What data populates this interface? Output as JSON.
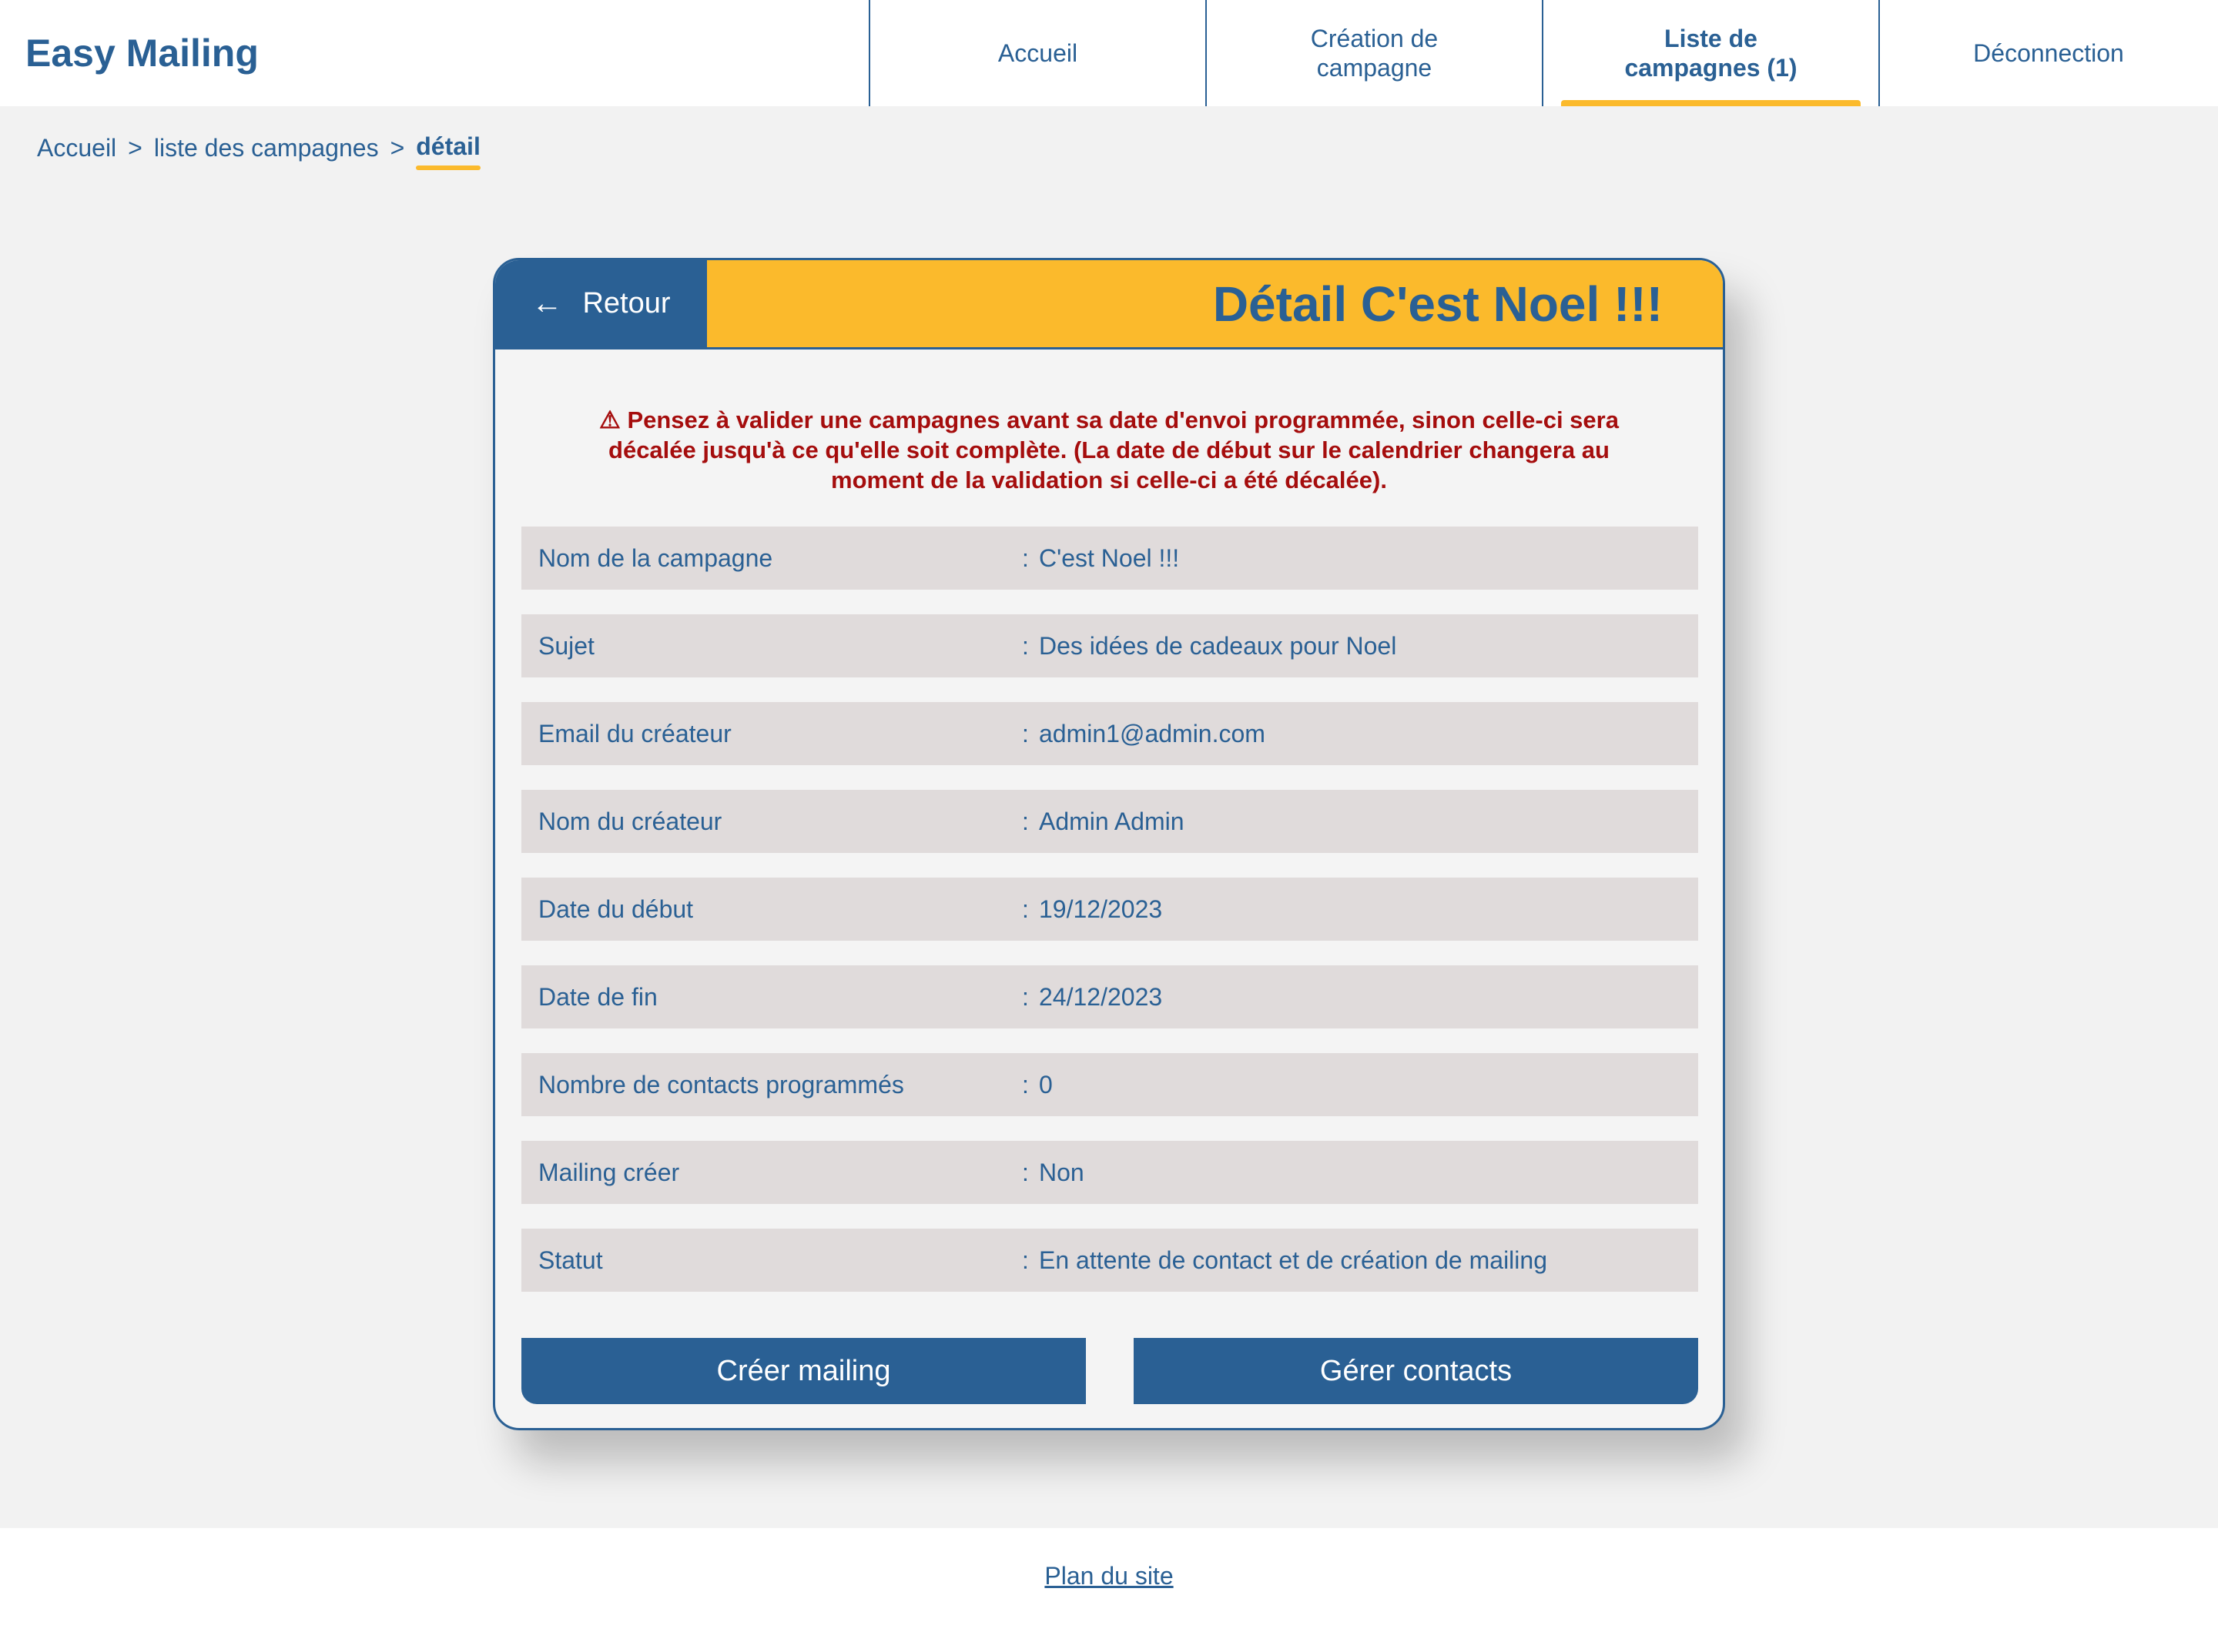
{
  "header": {
    "brand": "Easy Mailing",
    "nav": [
      {
        "label": "Accueil"
      },
      {
        "label": "Création de campagne"
      },
      {
        "label": "Liste de campagnes (1)"
      },
      {
        "label": "Déconnection"
      }
    ],
    "active_index": 2,
    "accent_color": "#fbba2c"
  },
  "breadcrumb": {
    "items": [
      "Accueil",
      "liste des campagnes",
      "détail"
    ],
    "separator": ">"
  },
  "card": {
    "back_icon": "←",
    "back_label": "Retour",
    "title": "Détail C'est Noel !!!",
    "warning_icon": "⚠",
    "warning": "Pensez à valider une campagnes avant sa date d'envoi programmée, sinon celle-ci sera décalée jusqu'à ce qu'elle soit complète. (La date de début sur le calendrier changera au moment de la validation si celle-ci a été décalée).",
    "details": [
      {
        "label": "Nom de la campagne",
        "value": "C'est Noel !!!"
      },
      {
        "label": "Sujet",
        "value": "Des idées de cadeaux pour Noel"
      },
      {
        "label": "Email du créateur",
        "value": "admin1@admin.com"
      },
      {
        "label": "Nom du créateur",
        "value": "Admin Admin"
      },
      {
        "label": "Date du début",
        "value": "19/12/2023"
      },
      {
        "label": "Date de fin",
        "value": "24/12/2023"
      },
      {
        "label": "Nombre de contacts programmés",
        "value": "0"
      },
      {
        "label": "Mailing créer",
        "value": "Non"
      },
      {
        "label": "Statut",
        "value": "En attente de contact et de création de mailing"
      }
    ],
    "buttons": {
      "create_mailing": "Créer mailing",
      "manage_contacts": "Gérer contacts"
    }
  },
  "footer": {
    "sitemap_link": "Plan du site"
  }
}
